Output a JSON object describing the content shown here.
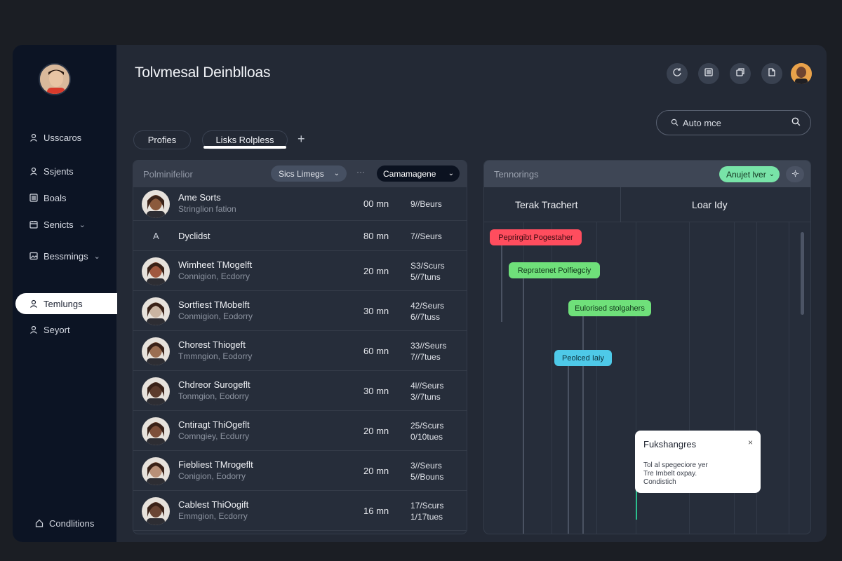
{
  "app": {
    "title": "Tolvmesal Deinblloas"
  },
  "sidebar": {
    "items": [
      {
        "label": "Usscaros",
        "icon": "user-icon"
      },
      {
        "label": "Ssjents",
        "icon": "person-icon"
      },
      {
        "label": "Boals",
        "icon": "list-icon"
      },
      {
        "label": "Senicts",
        "icon": "calendar-icon",
        "has_chevron": true
      },
      {
        "label": "Bessmings",
        "icon": "image-icon",
        "has_chevron": true
      },
      {
        "label": "Temlungs",
        "icon": "person-icon",
        "active": true
      },
      {
        "label": "Seyort",
        "icon": "person-icon"
      }
    ],
    "footer_label": "Condlitions"
  },
  "header": {
    "icons": [
      "refresh-icon",
      "list-icon",
      "copy-icon",
      "file-icon"
    ]
  },
  "search": {
    "value": "Auto mce"
  },
  "tabs": [
    {
      "label": "Profies"
    },
    {
      "label": "Lisks Rolpless",
      "active": true
    }
  ],
  "table": {
    "title": "Polminifelior",
    "filter_label": "Sics Limegs",
    "dots": "···",
    "dropdown_label": "Camamagene",
    "rows": [
      {
        "name": "Ame Sorts",
        "sub": "Stringlion fation",
        "duration": "00 mn",
        "status1": "9//Beurs",
        "status2": "",
        "avatar_color": "#8b5a3c"
      },
      {
        "name": "Dyclidst",
        "sub": "",
        "duration": "80 mn",
        "status1": "7//Seurs",
        "status2": "",
        "letter": "A"
      },
      {
        "name": "Wimheet TMogelft",
        "sub": "Connigion, Ecdorry",
        "duration": "20 mn",
        "status1": "S3/Scurs",
        "status2": "5//7tuns",
        "avatar_color": "#a0583f"
      },
      {
        "name": "Sortfiest TMobelft",
        "sub": "Conmigion, Eodorry",
        "duration": "30 mn",
        "status1": "42/Seurs",
        "status2": "6//7tuss",
        "avatar_color": "#c9b4a2"
      },
      {
        "name": "Chorest Thiogeft",
        "sub": "Tmmngion, Eodorry",
        "duration": "60 mn",
        "status1": "33//Seurs",
        "status2": "7//7tues",
        "avatar_color": "#9a6e52"
      },
      {
        "name": "Chdreor Surogeflt",
        "sub": "Tonmgion, Eodorry",
        "duration": "30 mn",
        "status1": "4l//Seurs",
        "status2": "3//7tuns",
        "avatar_color": "#5c3b2c"
      },
      {
        "name": "Cntiragt ThiOgeflt",
        "sub": "Comngiey, Ecdurry",
        "duration": "20 mn",
        "status1": "25/Scurs",
        "status2": "0/10tues",
        "avatar_color": "#7d4f3a"
      },
      {
        "name": "Fiebliest TMrogeflt",
        "sub": "Conigion, Eodorry",
        "duration": "20 mn",
        "status1": "3//Seurs",
        "status2": "5//Bouns",
        "avatar_color": "#b89078"
      },
      {
        "name": "Cablest ThiOogift",
        "sub": "Emmgion, Ecdorry",
        "duration": "16 mn",
        "status1": "17/Scurs",
        "status2": "1/17tues",
        "avatar_color": "#6a4534"
      }
    ]
  },
  "timeline": {
    "title": "Tennorings",
    "filter_label": "Anujet lver",
    "columns": [
      "Terak Trachert",
      "Loar Idy"
    ],
    "bars": [
      {
        "label": "Peprirgibt Pogestaher",
        "color": "#ff4d5e",
        "text_color": "#3a0a10"
      },
      {
        "label": "Repratenet Polfiegciy",
        "color": "#6fe07a",
        "text_color": "#10351a"
      },
      {
        "label": "Eulorised stolgahers",
        "color": "#6fe07a",
        "text_color": "#10351a"
      },
      {
        "label": "Peolced Iaiy",
        "color": "#4ec9e8",
        "text_color": "#0b2f3a"
      }
    ],
    "popup": {
      "title": "Fukshangres",
      "close": "×",
      "body": "Tol al spegeciore yer\nTre Imbelt oxpay.\nCondistich"
    }
  }
}
